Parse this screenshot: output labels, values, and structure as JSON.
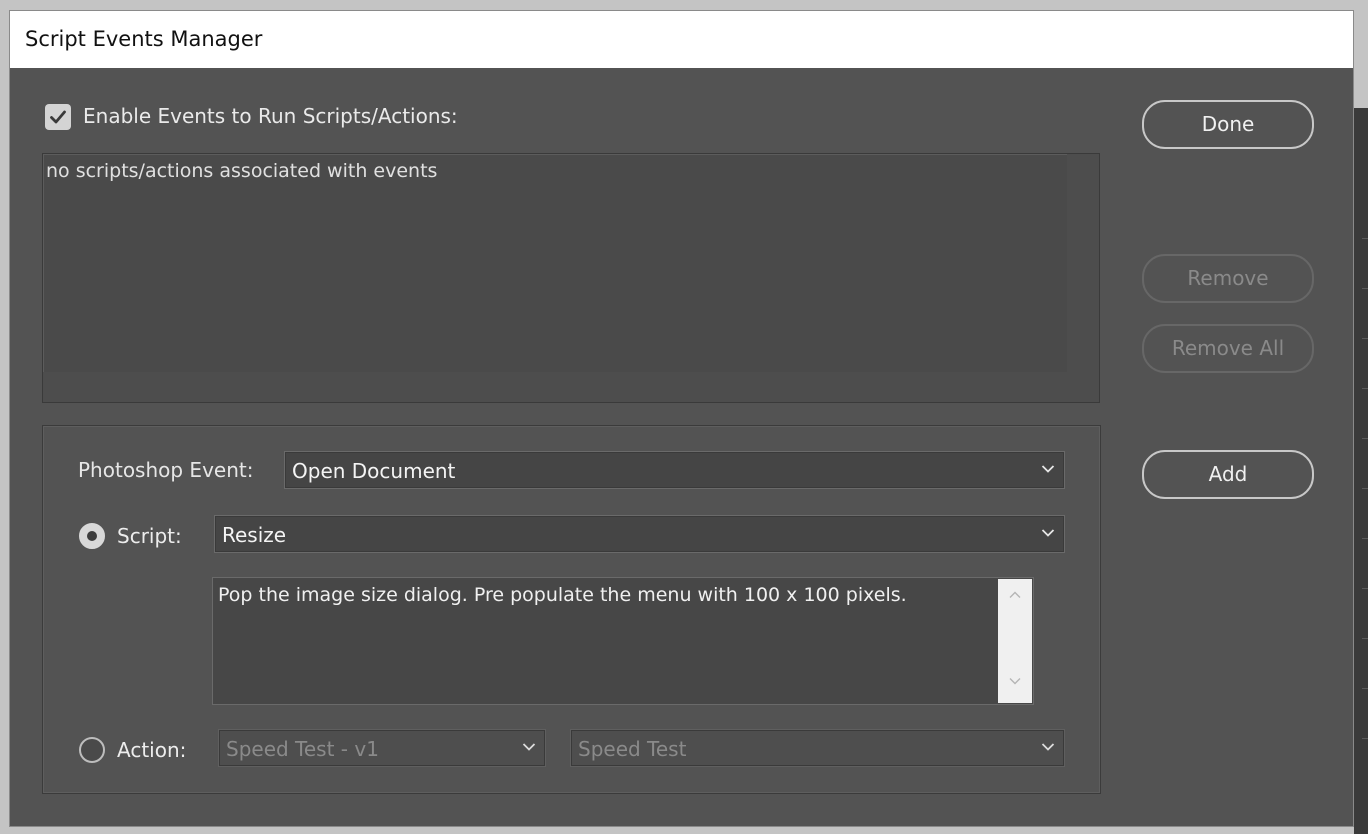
{
  "window": {
    "title": "Script Events Manager"
  },
  "enable": {
    "label": "Enable Events to Run Scripts/Actions:",
    "checked": true
  },
  "event_list": {
    "empty_text": "no scripts/actions associated with events"
  },
  "buttons": {
    "done": "Done",
    "remove": "Remove",
    "remove_all": "Remove All",
    "add": "Add"
  },
  "form": {
    "photoshop_event_label": "Photoshop Event:",
    "photoshop_event_value": "Open Document",
    "script_label": "Script:",
    "script_value": "Resize",
    "script_selected": true,
    "script_description": "Pop the image size dialog. Pre populate the menu with 100 x 100 pixels.",
    "action_label": "Action:",
    "action_set_value": "Speed Test - v1",
    "action_value": "Speed Test",
    "action_selected": false
  },
  "icons": {
    "checkmark": "checkmark-icon",
    "dropdown": "chevron-down-icon",
    "scroll_up": "chevron-up-icon",
    "scroll_down": "chevron-down-icon"
  }
}
